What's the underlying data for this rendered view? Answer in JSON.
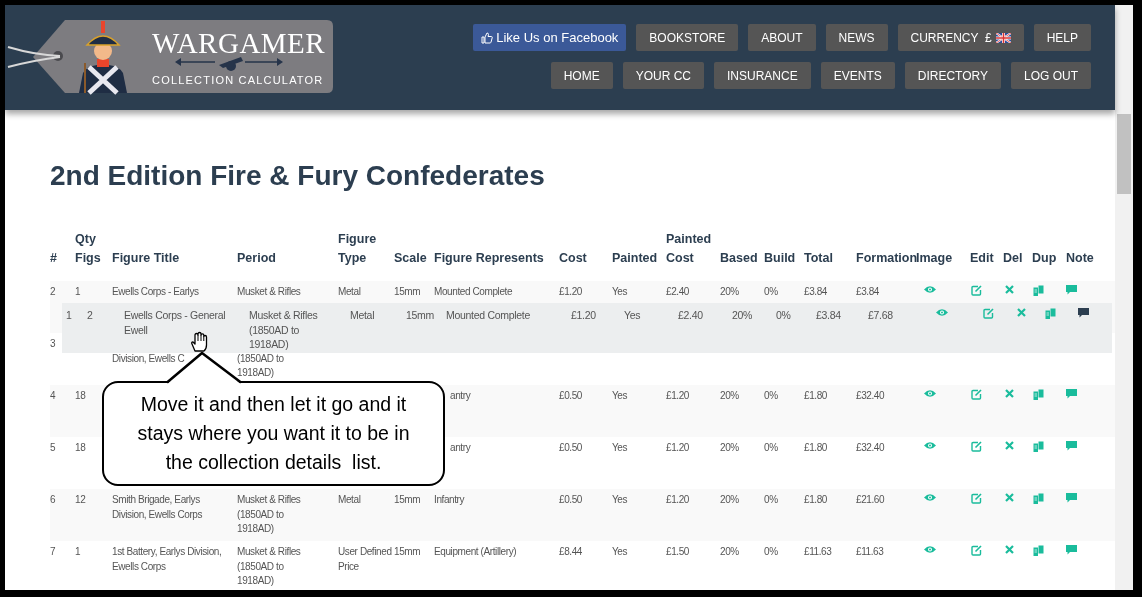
{
  "header": {
    "logo": {
      "title": "WARGAMER",
      "subtitle": "COLLECTION CALCULATOR"
    },
    "nav_rows": [
      [
        {
          "label": "Like Us on Facebook",
          "kind": "facebook"
        },
        {
          "label": "BOOKSTORE",
          "kind": "plain"
        },
        {
          "label": "ABOUT",
          "kind": "plain"
        },
        {
          "label": "NEWS",
          "kind": "plain"
        },
        {
          "label": "CURRENCY",
          "symbol": "£",
          "kind": "currency"
        },
        {
          "label": "HELP",
          "kind": "plain"
        }
      ],
      [
        {
          "label": "HOME",
          "kind": "plain"
        },
        {
          "label": "YOUR CC",
          "kind": "plain"
        },
        {
          "label": "INSURANCE",
          "kind": "plain"
        },
        {
          "label": "EVENTS",
          "kind": "plain"
        },
        {
          "label": "DIRECTORY",
          "kind": "plain"
        },
        {
          "label": "LOG OUT",
          "kind": "plain"
        }
      ]
    ]
  },
  "page_title": "2nd Edition Fire & Fury Confederates",
  "table": {
    "columns": [
      "#",
      "Qty Figs",
      "Figure Title",
      "Period",
      "Figure Type",
      "Scale",
      "Figure Represents",
      "Cost",
      "Painted",
      "Painted Cost",
      "Based",
      "Build",
      "Total",
      "Formation",
      "Image",
      "Edit",
      "Del",
      "Dup",
      "Note"
    ],
    "rows": [
      {
        "num": "2",
        "qty": "1",
        "title": "Ewells Corps - Earlys",
        "period": "Musket & Rifles",
        "type": "Metal",
        "scale": "15mm",
        "represents": "Mounted Complete",
        "cost": "£1.20",
        "painted": "Yes",
        "painted_cost": "£2.40",
        "based": "20%",
        "build": "0%",
        "total": "£3.84",
        "formation": "£3.84",
        "note_highlighted": false
      },
      {
        "num": "3",
        "title": "Division, Ewells C",
        "period": "(1850AD to 1918AD)"
      },
      {
        "num": "4",
        "qty": "18",
        "represents": "antry",
        "cost": "£0.50",
        "painted": "Yes",
        "painted_cost": "£1.20",
        "based": "20%",
        "build": "0%",
        "total": "£1.80",
        "formation": "£32.40",
        "note_highlighted": false
      },
      {
        "num": "5",
        "qty": "18",
        "represents": "antry",
        "cost": "£0.50",
        "painted": "Yes",
        "painted_cost": "£1.20",
        "based": "20%",
        "build": "0%",
        "total": "£1.80",
        "formation": "£32.40",
        "note_highlighted": false
      },
      {
        "num": "6",
        "qty": "12",
        "title": "Smith Brigade, Earlys Division, Ewells Corps",
        "period": "Musket & Rifles (1850AD to 1918AD)",
        "type": "Metal",
        "scale": "15mm",
        "represents": "Infantry",
        "cost": "£0.50",
        "painted": "Yes",
        "painted_cost": "£1.20",
        "based": "20%",
        "build": "0%",
        "total": "£1.80",
        "formation": "£21.60",
        "note_highlighted": false
      },
      {
        "num": "7",
        "qty": "1",
        "title": "1st Battery, Earlys Division, Ewells Corps",
        "period": "Musket & Rifles (1850AD to 1918AD)",
        "type": "User Defined Price",
        "scale": "15mm",
        "represents": "Equipment (Artillery)",
        "cost": "£8.44",
        "painted": "Yes",
        "painted_cost": "£1.50",
        "based": "20%",
        "build": "0%",
        "total": "£11.63",
        "formation": "£11.63",
        "note_highlighted": false
      }
    ]
  },
  "dragged_row": {
    "num": "1",
    "qty": "2",
    "title": "Ewells Corps - General Ewell",
    "period": "Musket & Rifles (1850AD to 1918AD)",
    "type": "Metal",
    "scale": "15mm",
    "represents": "Mounted Complete",
    "cost": "£1.20",
    "painted": "Yes",
    "painted_cost": "£2.40",
    "based": "20%",
    "build": "0%",
    "total": "£3.84",
    "formation": "£7.68",
    "note_highlighted": true
  },
  "callout": {
    "text": "Move it and then let it go and it stays where you want it to be in the collection details  list."
  }
}
